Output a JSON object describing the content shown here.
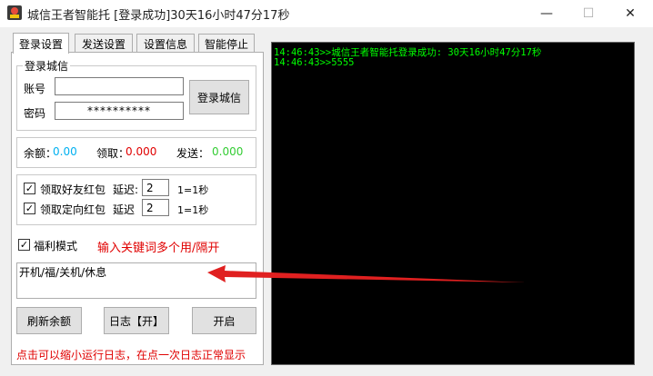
{
  "window": {
    "title": "城信王者智能托 [登录成功]30天16小时47分17秒",
    "minimize_icon": "—",
    "maximize_icon": "☐",
    "close_icon": "✕",
    "accent": "#cc0000"
  },
  "tabs": [
    {
      "label": "登录设置",
      "active": true
    },
    {
      "label": "发送设置",
      "active": false
    },
    {
      "label": "设置信息",
      "active": false
    },
    {
      "label": "智能停止",
      "active": false
    }
  ],
  "login": {
    "group_title": "登录城信",
    "account_label": "账号",
    "account_value": "",
    "password_label": "密码",
    "password_value": "**********",
    "login_button": "登录城信"
  },
  "balance": {
    "balance_label": "余额：",
    "balance_value": "0.00",
    "balance_color": "#00b0f0",
    "receive_label": "领取：",
    "receive_value": "0.000",
    "receive_color": "#e00000",
    "send_label": "发送：",
    "send_value": "0.000",
    "send_color": "#33cc33"
  },
  "redpacket": {
    "friend_label": "领取好友红包",
    "friend_checked": true,
    "friend_delay_label": "延迟:",
    "friend_delay_value": "2",
    "friend_unit": "1=1秒",
    "directed_label": "领取定向红包",
    "directed_checked": true,
    "directed_delay_label": "延迟",
    "directed_delay_value": "2",
    "directed_unit": "1=1秒"
  },
  "welfare": {
    "label": "福利模式",
    "checked": true,
    "hint": "输入关键词多个用/隔开",
    "keywords_value": "开机/福/关机/休息"
  },
  "actions": {
    "refresh_button": "刷新余额",
    "log_button": "日志【开】",
    "start_button": "开启"
  },
  "footer_note": "点击可以缩小运行日志，在点一次日志正常显示",
  "console": {
    "lines": [
      "14:46:43>>城信王者智能托登录成功: 30天16小时47分17秒",
      "14:46:43>>5555"
    ]
  }
}
